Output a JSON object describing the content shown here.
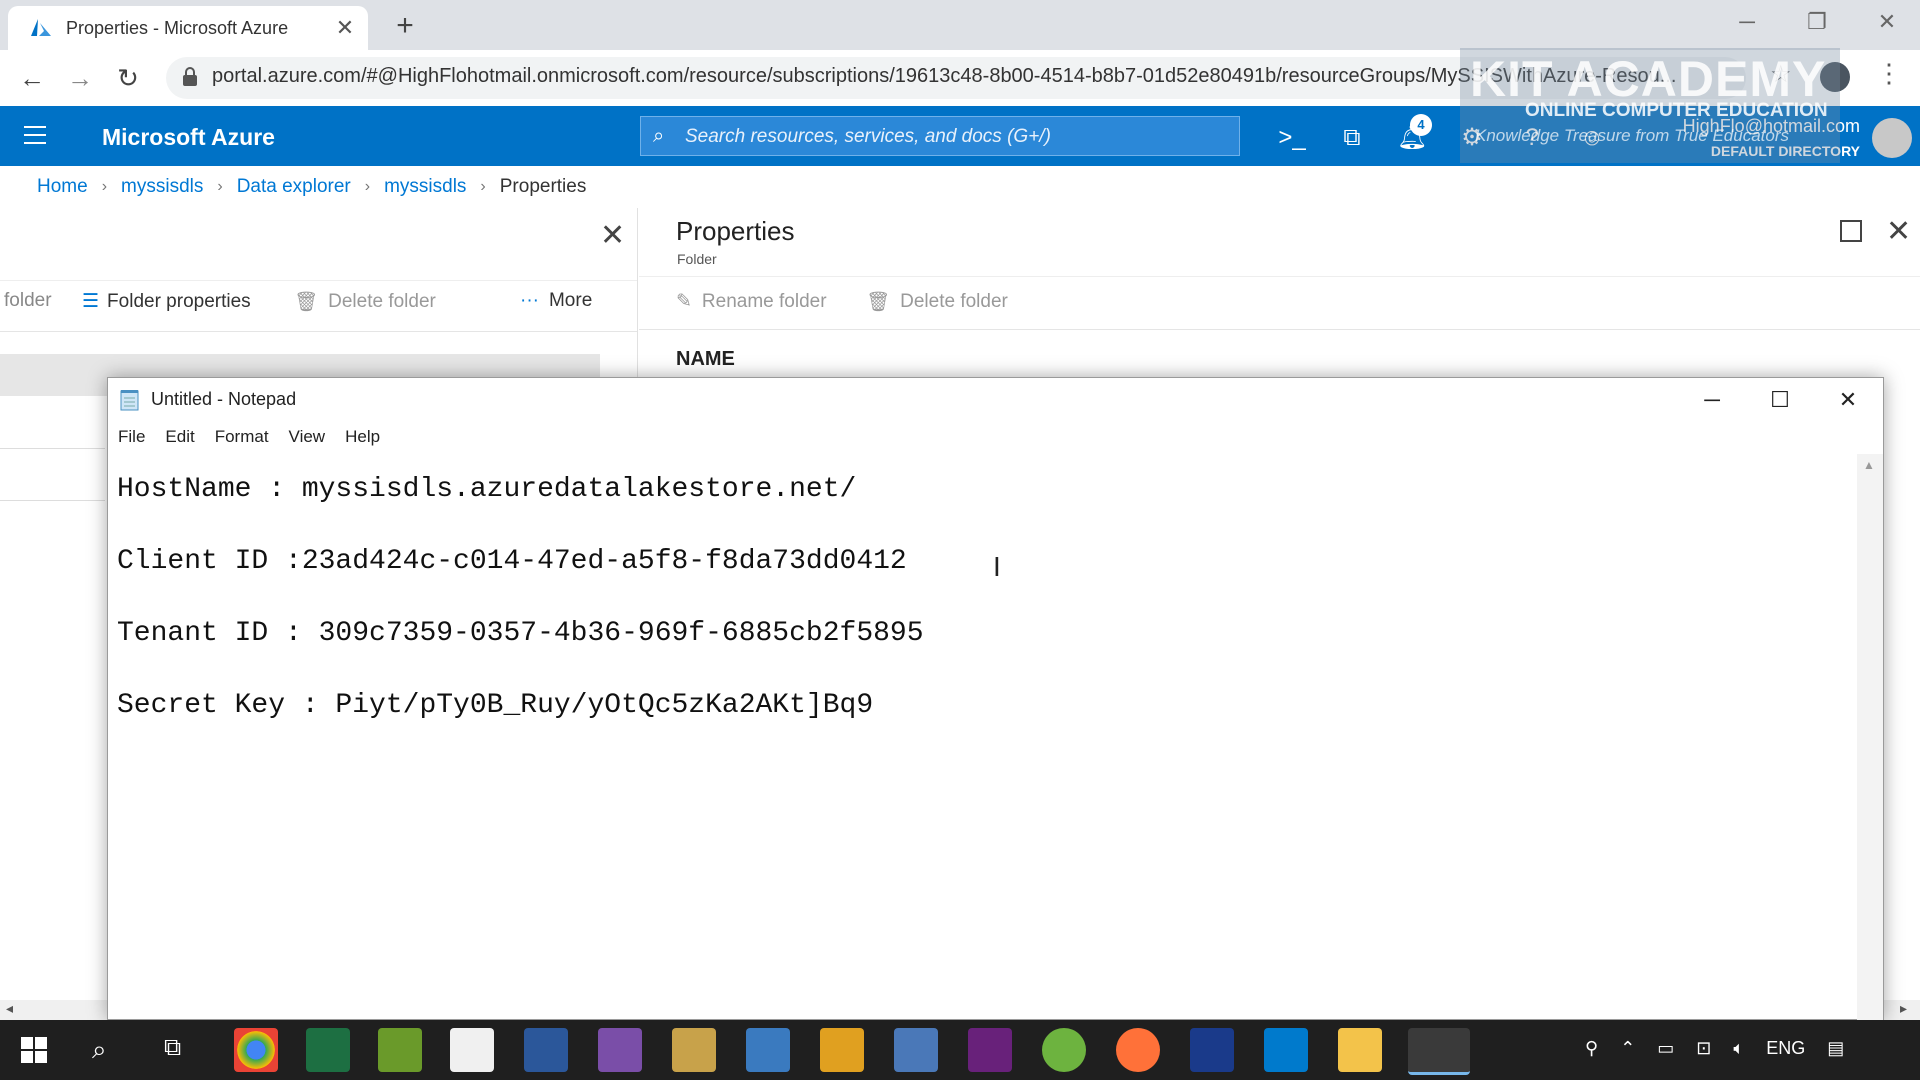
{
  "browser": {
    "tab_title": "Properties - Microsoft Azure",
    "url": "portal.azure.com/#@HighFlohotmail.onmicrosoft.com/resource/subscriptions/19613c48-8b00-4514-b8b7-01d52e80491b/resourceGroups/MySSISWithAzure-Resou..."
  },
  "watermark": {
    "line1": "KIT ACADEMY",
    "line2": "ONLINE COMPUTER EDUCATION",
    "line3": "Knowledge Treasure from True Educators"
  },
  "azure": {
    "brand": "Microsoft Azure",
    "search_placeholder": "Search resources, services, and docs (G+/)",
    "notification_count": "4",
    "account": "HighFlo@hotmail.com",
    "directory": "DEFAULT DIRECTORY"
  },
  "breadcrumb": [
    "Home",
    "myssisdls",
    "Data explorer",
    "myssisdls",
    "Properties"
  ],
  "left_blade": {
    "toolbar": {
      "folder_partial": "folder",
      "folder_properties": "Folder properties",
      "delete_folder": "Delete folder",
      "more": "More"
    }
  },
  "right_blade": {
    "title": "Properties",
    "subtitle": "Folder",
    "toolbar": {
      "rename_folder": "Rename folder",
      "delete_folder": "Delete folder"
    },
    "name_header": "NAME"
  },
  "notepad": {
    "title": "Untitled - Notepad",
    "menu": [
      "File",
      "Edit",
      "Format",
      "View",
      "Help"
    ],
    "lines": [
      "HostName : myssisdls.azuredatalakestore.net/",
      "Client ID :23ad424c-c014-47ed-a5f8-f8da73dd0412",
      "Tenant ID : 309c7359-0357-4b36-969f-6885cb2f5895",
      "Secret Key : Piyt/pTy0B_Ruy/yOtQc5zKa2AKt]Bq9"
    ]
  },
  "taskbar": {
    "language": "ENG"
  },
  "colors": {
    "azure_blue": "#0072c6",
    "link_blue": "#0078d4",
    "taskbar": "#1f1f1f"
  }
}
